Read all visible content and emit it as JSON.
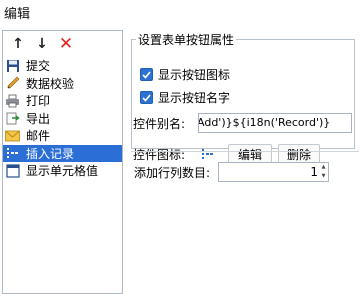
{
  "window": {
    "title": "编辑"
  },
  "toolbar": {
    "move_up": "↑",
    "move_down": "↓",
    "delete": "✕"
  },
  "items": [
    {
      "label": "提交",
      "icon": "save-icon"
    },
    {
      "label": "数据校验",
      "icon": "pencil-icon"
    },
    {
      "label": "打印",
      "icon": "printer-icon"
    },
    {
      "label": "导出",
      "icon": "export-icon"
    },
    {
      "label": "邮件",
      "icon": "mail-icon"
    },
    {
      "label": "插入记录",
      "icon": "insert-row-icon",
      "selected": true
    },
    {
      "label": "显示单元格值",
      "icon": "cell-icon"
    }
  ],
  "properties": {
    "group_title": "设置表单按钮属性",
    "show_icon_label": "显示按钮图标",
    "show_icon_checked": true,
    "show_name_label": "显示按钮名字",
    "show_name_checked": true,
    "alias_label": "控件别名:",
    "alias_value": "Add')}${i18n('Record')}",
    "icon_label": "控件图标:",
    "edit_button": "编辑",
    "delete_button": "删除",
    "add_rows_label": "添加行列数目:",
    "add_rows_value": "1"
  },
  "colors": {
    "selection": "#2b6fd6",
    "checkbox": "#2a73d2",
    "delete": "#e02020"
  }
}
